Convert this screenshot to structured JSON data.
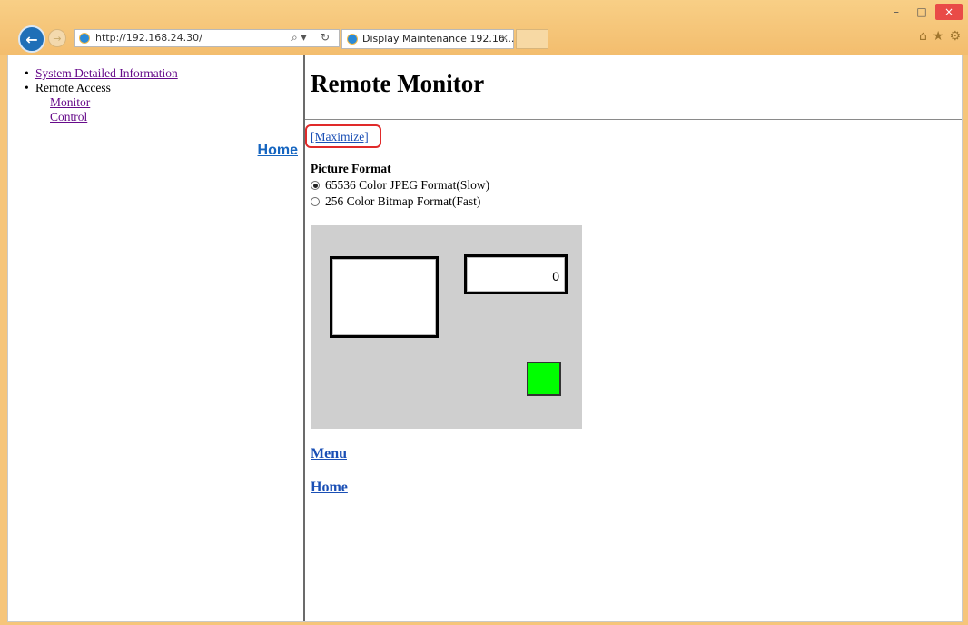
{
  "browser": {
    "url": "http://192.168.24.30/",
    "tab_title": "Display Maintenance 192.16...",
    "tab_close": "×",
    "back_glyph": "←",
    "forward_glyph": "→",
    "search_glyph": "⌕ ▾",
    "refresh_glyph": "↻",
    "window_controls": {
      "minimize": "–",
      "maximize": "□",
      "close": "×"
    },
    "toolbar_icons": [
      "home-icon",
      "favorites-icon",
      "settings-icon"
    ],
    "toolbar_glyphs": {
      "home": "⌂",
      "favorites": "★",
      "settings": "⚙"
    }
  },
  "left_nav": {
    "items": [
      {
        "label": "System Detailed Information",
        "link": true
      },
      {
        "label": "Remote Access",
        "link": false
      }
    ],
    "sub_items": [
      {
        "label": "Monitor"
      },
      {
        "label": "Control"
      }
    ],
    "home_label": "Home"
  },
  "main": {
    "title": "Remote Monitor",
    "maximize_label": "[Maximize]",
    "picture_format_label": "Picture Format",
    "formats": [
      {
        "label": "65536 Color JPEG Format(Slow)",
        "selected": true
      },
      {
        "label": "256 Color Bitmap Format(Fast)",
        "selected": false
      }
    ],
    "monitor": {
      "numeric_display_value": "0",
      "lamp_color": "#00ff00"
    },
    "menu_label": "Menu",
    "home_label": "Home"
  },
  "colors": {
    "highlight": "#e02a2a",
    "link": "#1a4fb5",
    "visited_link": "#660a8a"
  }
}
